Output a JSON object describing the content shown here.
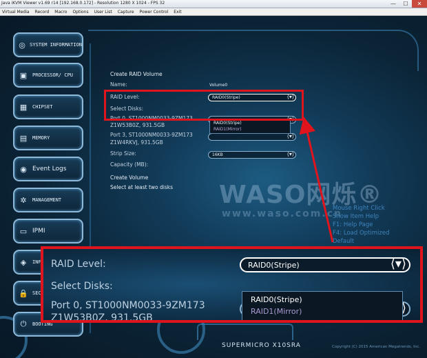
{
  "window": {
    "title": "Java iKVM Viewer v1.69 r14 [192.168.0.172] - Resolution 1280 X 1024 - FPS 32",
    "minimize_glyph": "—",
    "maximize_glyph": "☐",
    "close_glyph": "✕"
  },
  "menu": [
    "Virtual Media",
    "Record",
    "Macro",
    "Options",
    "User List",
    "Capture",
    "Power Control",
    "Exit"
  ],
  "sidebar": [
    {
      "label": "SYSTEM INFORMATION",
      "icon": "system-info-icon",
      "glyph": "◎"
    },
    {
      "label": "PROCESSOR/ CPU",
      "icon": "processor-icon",
      "glyph": "▣"
    },
    {
      "label": "CHIPSET",
      "icon": "chipset-icon",
      "glyph": "▦"
    },
    {
      "label": "MEMORY",
      "icon": "memory-icon",
      "glyph": "▤"
    },
    {
      "label": "Event Logs",
      "icon": "event-logs-icon",
      "glyph": "◉"
    },
    {
      "label": "MANAGEMENT",
      "icon": "management-icon",
      "glyph": "✲"
    },
    {
      "label": "IPMI",
      "icon": "ipmi-icon",
      "glyph": "▭"
    },
    {
      "label": "INF",
      "icon": "info-icon",
      "glyph": "◈"
    },
    {
      "label": "SEC",
      "icon": "security-icon",
      "glyph": "🔒"
    },
    {
      "label": "BOOTING",
      "icon": "booting-icon",
      "glyph": "⏻"
    }
  ],
  "form": {
    "heading": "Create RAID Volume",
    "name_label": "Name:",
    "name_value": "Volume0",
    "raid_level_label": "RAID Level:",
    "raid_level_value": "RAID0(Stripe)",
    "select_disks_label": "Select Disks:",
    "disk0_line1": "Port 0, ST1000NM0033-9ZM173",
    "disk0_line2": "Z1W53B0Z, 931.5GB",
    "disk3_line1": "Port 3, ST1000NM0033-9ZM173",
    "disk3_line2": "Z1W4RKVJ, 931.5GB",
    "strip_size_label": "Strip Size:",
    "strip_size_value": "16KB",
    "capacity_label": "Capacity (MB):",
    "create_volume": "Create Volume",
    "notice": "Select at least two disks",
    "dropdown_options": [
      "RAID0(Stripe)",
      "RAID1(Mirror)"
    ],
    "arrow_glyph": "⟨▾⟩"
  },
  "help": [
    "Mouse Right Click",
    "Show Item Help",
    "F1: Help Page",
    "F4: Load Optimized",
    "Default"
  ],
  "watermark": {
    "text": "WASO网烁®",
    "url": "www.waso.com.cn"
  },
  "zoom": {
    "raid_level_label": "RAID Level:",
    "raid_level_value": "RAID0(Stripe)",
    "select_disks_label": "Select Disks:",
    "disk0_line1": "Port 0, ST1000NM0033-9ZM173",
    "disk0_line2": "Z1W53B0Z, 931.5GB",
    "options": [
      "RAID0(Stripe)",
      "RAID1(Mirror)"
    ]
  },
  "footer": {
    "brand": "SUPERMICRO X10SRA",
    "copyright": "Copyright (C) 2015 American Megatrends, Inc."
  },
  "colors": {
    "highlight": "#e0141d",
    "accent": "#3b7fb0"
  }
}
